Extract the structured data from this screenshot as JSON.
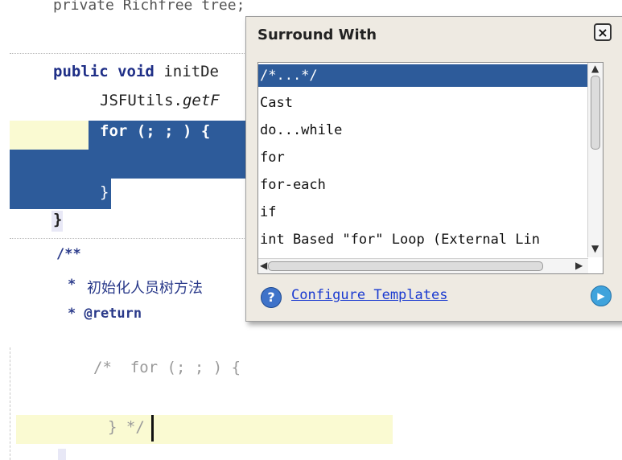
{
  "editor": {
    "line_private_partial": "private Richfree tree;",
    "kw_public": "public",
    "kw_void": "void",
    "method_partial": "initDe",
    "jsf_call_prefix": "JSFUtils.",
    "jsf_call_italic": "getF",
    "for_line": "for (; ; ) {",
    "close_brace_inner": "}",
    "close_brace_outer": "}",
    "javadoc_open": "/**",
    "javadoc_star": "*",
    "chinese_comment": "初始化人员树方法",
    "return_tag": "* @return"
  },
  "popup": {
    "title": "Surround With",
    "close_label": "×",
    "items": [
      "/*...*/",
      "Cast",
      "do...while",
      "for",
      "for-each",
      "if",
      "int Based \"for\" Loop (External Lin"
    ],
    "selected_index": 0,
    "configure_link": "Configure Templates",
    "help_glyph": "?",
    "go_glyph": "▶"
  },
  "editor2": {
    "line1": "/*  for (; ; ) {",
    "line2": "} */"
  },
  "colors": {
    "selection": "#2d5b9a",
    "keyword": "#1f2f87",
    "link": "#1a3ad0",
    "current_line": "#fafad2"
  }
}
